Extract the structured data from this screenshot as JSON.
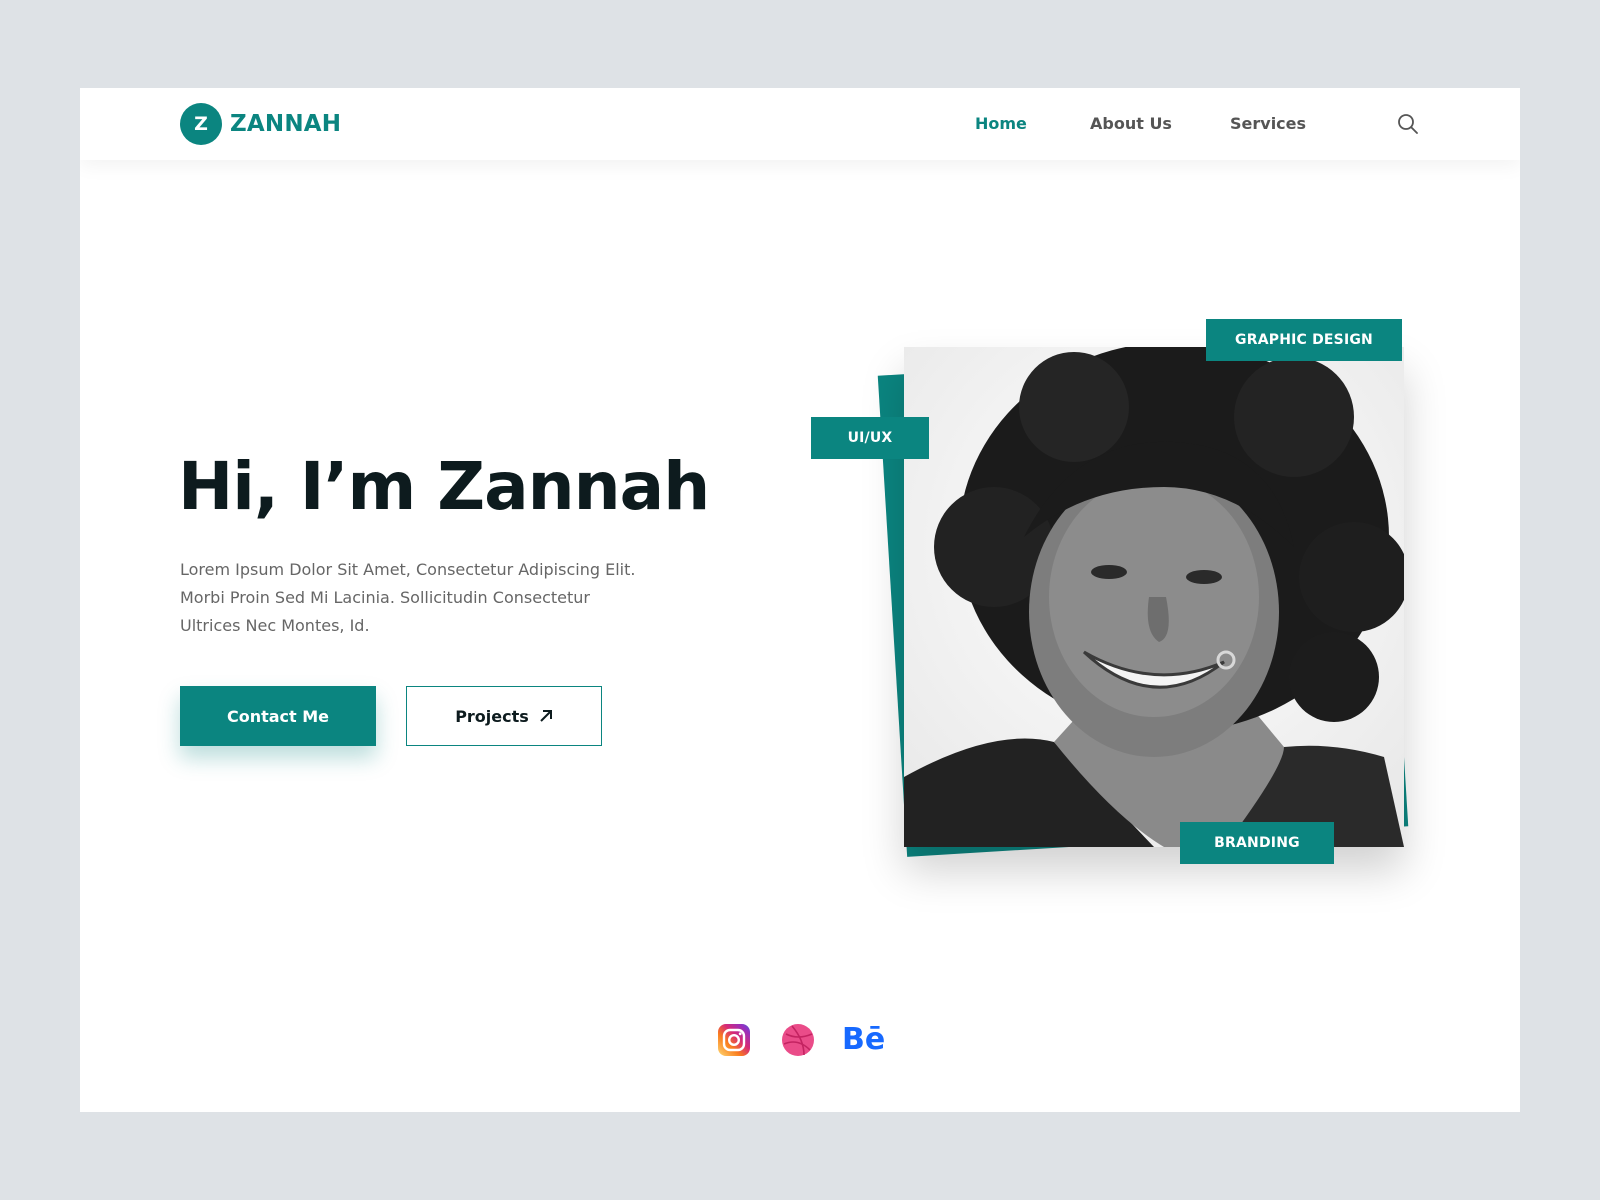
{
  "header": {
    "logo_mark": "Z",
    "logo_text": "ZANNAH",
    "nav": [
      "Home",
      "About Us",
      "Services"
    ],
    "active_nav": "Home",
    "search_icon": "search-icon"
  },
  "hero": {
    "title": "Hi, I’m Zannah",
    "description": "Lorem Ipsum Dolor Sit Amet, Consectetur Adipiscing Elit. Morbi Proin Sed Mi Lacinia. Sollicitudin Consectetur Ultrices Nec Montes, Id.",
    "contact_label": "Contact Me",
    "projects_label": "Projects",
    "projects_icon": "arrow-up-right-icon"
  },
  "tags": {
    "graphic_design": "GRAPHIC DESIGN",
    "uiux": "UI/UX",
    "branding": "BRANDING"
  },
  "socials": {
    "instagram_icon": "instagram-icon",
    "dribbble_icon": "dribbble-icon",
    "behance_label": "Bē"
  },
  "colors": {
    "accent": "#0b8580",
    "background": "#dee2e6",
    "heading": "#0d1b1e",
    "behance": "#1769ff"
  }
}
